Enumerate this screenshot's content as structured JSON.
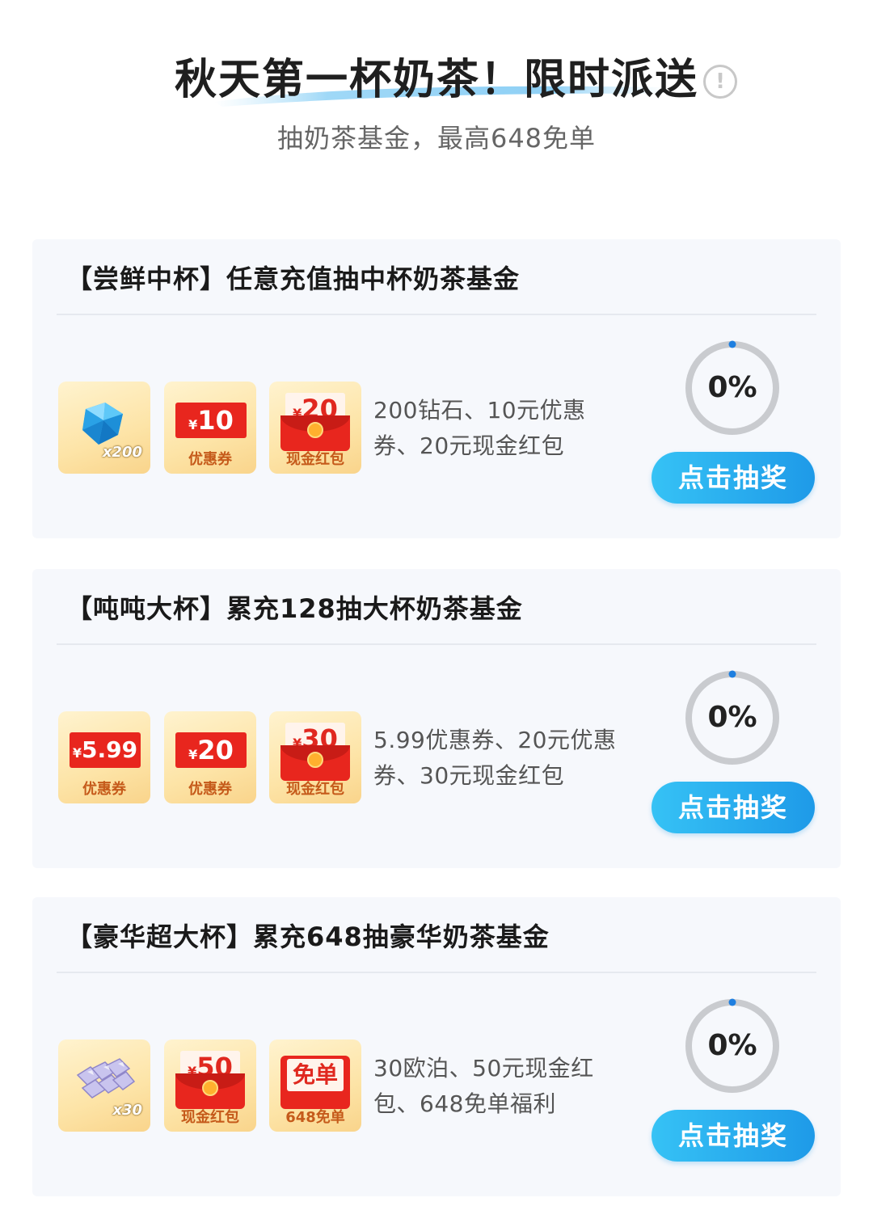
{
  "header": {
    "title": "秋天第一杯奶茶！限时派送",
    "info_icon": "!",
    "subtitle": "抽奶茶基金，最高648免单"
  },
  "colors": {
    "accent": "#1e9ae8",
    "coupon_red": "#e8261e",
    "card_bg": "#f6f8fc"
  },
  "cards": [
    {
      "title": "【尝鲜中杯】任意充值抽中杯奶茶基金",
      "prizes": [
        {
          "icon": "diamond-icon",
          "count": "x200",
          "label": ""
        },
        {
          "icon": "coupon-icon",
          "yen": "¥",
          "amount": "10",
          "label": "优惠券"
        },
        {
          "icon": "red-envelope-icon",
          "yen": "¥",
          "amount": "20",
          "label": "现金红包"
        }
      ],
      "description": "200钻石、10元优惠券、20元现金红包",
      "progress_text": "0%",
      "progress": 0,
      "button": "点击抽奖"
    },
    {
      "title": "【吨吨大杯】累充128抽大杯奶茶基金",
      "prizes": [
        {
          "icon": "coupon-icon",
          "yen": "¥",
          "amount": "5.99",
          "label": "优惠券"
        },
        {
          "icon": "coupon-icon",
          "yen": "¥",
          "amount": "20",
          "label": "优惠券"
        },
        {
          "icon": "red-envelope-icon",
          "yen": "¥",
          "amount": "30",
          "label": "现金红包"
        }
      ],
      "description": "5.99优惠券、20元优惠券、30元现金红包",
      "progress_text": "0%",
      "progress": 0,
      "button": "点击抽奖"
    },
    {
      "title": "【豪华超大杯】累充648抽豪华奶茶基金",
      "prizes": [
        {
          "icon": "crystal-icon",
          "count": "x30",
          "label": ""
        },
        {
          "icon": "red-envelope-icon",
          "yen": "¥",
          "amount": "50",
          "label": "现金红包"
        },
        {
          "icon": "free-order-icon",
          "amount": "免单",
          "label": "648免单"
        }
      ],
      "description": "30欧泊、50元现金红包、648免单福利",
      "progress_text": "0%",
      "progress": 0,
      "button": "点击抽奖"
    }
  ]
}
